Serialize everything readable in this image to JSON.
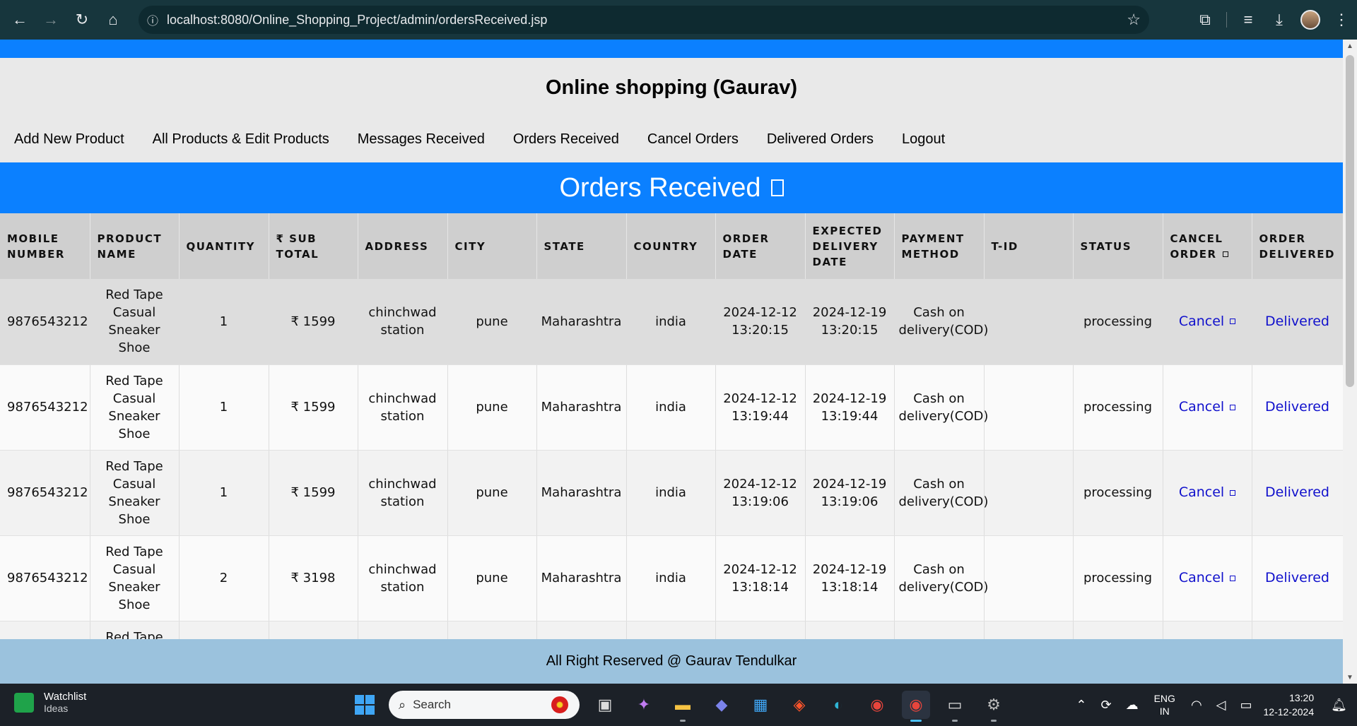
{
  "browser": {
    "url": "localhost:8080/Online_Shopping_Project/admin/ordersReceived.jsp"
  },
  "site": {
    "title": "Online shopping (Gaurav)"
  },
  "menu": [
    {
      "label": "Add New Product"
    },
    {
      "label": "All Products & Edit Products"
    },
    {
      "label": "Messages Received"
    },
    {
      "label": "Orders Received"
    },
    {
      "label": "Cancel Orders"
    },
    {
      "label": "Delivered Orders"
    },
    {
      "label": "Logout"
    }
  ],
  "section": {
    "title": "Orders Received"
  },
  "table": {
    "headers": [
      "MOBILE NUMBER",
      "PRODUCT NAME",
      "QUANTITY",
      "₹ SUB TOTAL",
      "ADDRESS",
      "CITY",
      "STATE",
      "COUNTRY",
      "ORDER DATE",
      "EXPECTED DELIVERY DATE",
      "PAYMENT METHOD",
      "T-ID",
      "STATUS",
      "CANCEL ORDER",
      "ORDER DELIVERED"
    ],
    "rows": [
      {
        "mobile": "9876543212",
        "product": "Red Tape Casual Sneaker Shoe",
        "quantity": "1",
        "subtotal": "₹ 1599",
        "address": "chinchwad station",
        "city": "pune",
        "state": "Maharashtra",
        "country": "india",
        "order_date": "2024-12-12 13:20:15",
        "delivery_date": "2024-12-19 13:20:15",
        "payment": "Cash on delivery(COD)",
        "tid": "",
        "status": "processing",
        "cancel": "Cancel",
        "delivered": "Delivered"
      },
      {
        "mobile": "9876543212",
        "product": "Red Tape Casual Sneaker Shoe",
        "quantity": "1",
        "subtotal": "₹ 1599",
        "address": "chinchwad station",
        "city": "pune",
        "state": "Maharashtra",
        "country": "india",
        "order_date": "2024-12-12 13:19:44",
        "delivery_date": "2024-12-19 13:19:44",
        "payment": "Cash on delivery(COD)",
        "tid": "",
        "status": "processing",
        "cancel": "Cancel",
        "delivered": "Delivered"
      },
      {
        "mobile": "9876543212",
        "product": "Red Tape Casual Sneaker Shoe",
        "quantity": "1",
        "subtotal": "₹ 1599",
        "address": "chinchwad station",
        "city": "pune",
        "state": "Maharashtra",
        "country": "india",
        "order_date": "2024-12-12 13:19:06",
        "delivery_date": "2024-12-19 13:19:06",
        "payment": "Cash on delivery(COD)",
        "tid": "",
        "status": "processing",
        "cancel": "Cancel",
        "delivered": "Delivered"
      },
      {
        "mobile": "9876543212",
        "product": "Red Tape Casual Sneaker Shoe",
        "quantity": "2",
        "subtotal": "₹ 3198",
        "address": "chinchwad station",
        "city": "pune",
        "state": "Maharashtra",
        "country": "india",
        "order_date": "2024-12-12 13:18:14",
        "delivery_date": "2024-12-19 13:18:14",
        "payment": "Cash on delivery(COD)",
        "tid": "",
        "status": "processing",
        "cancel": "Cancel",
        "delivered": "Delivered"
      },
      {
        "mobile": "",
        "product": "Red Tape",
        "quantity": "",
        "subtotal": "",
        "address": "",
        "city": "",
        "state": "",
        "country": "",
        "order_date": "",
        "delivery_date": "",
        "payment": "",
        "tid": "",
        "status": "",
        "cancel": "",
        "delivered": ""
      }
    ]
  },
  "footer": {
    "text": "All Right Reserved @ Gaurav Tendulkar"
  },
  "taskbar": {
    "widget_title": "Watchlist",
    "widget_subtitle": "Ideas",
    "search_placeholder": "Search",
    "lang_line1": "ENG",
    "lang_line2": "IN",
    "time": "13:20",
    "date": "12-12-2024"
  },
  "colors": {
    "brand_blue": "#0b80ff",
    "footer_blue": "#9bc2dd",
    "link_blue": "#1010cc"
  }
}
